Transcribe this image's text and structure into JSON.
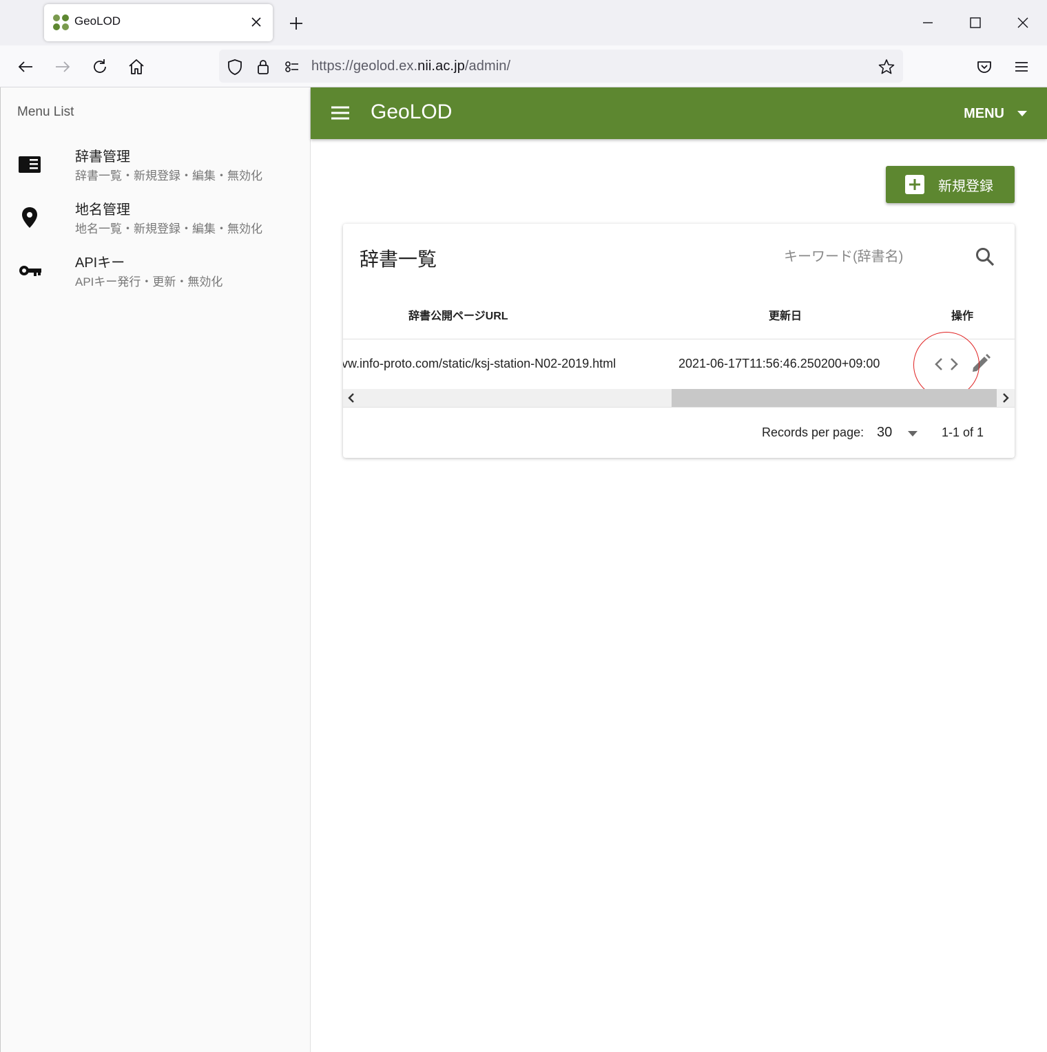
{
  "browser": {
    "tab_title": "GeoLOD",
    "url_prefix": "https://geolod.ex.",
    "url_host": "nii.ac.jp",
    "url_path": "/admin/"
  },
  "sidebar": {
    "title": "Menu List",
    "items": [
      {
        "label": "辞書管理",
        "sub": "辞書一覧・新規登録・編集・無効化",
        "icon": "book-icon"
      },
      {
        "label": "地名管理",
        "sub": "地名一覧・新規登録・編集・無効化",
        "icon": "map-pin-icon"
      },
      {
        "label": "APIキー",
        "sub": "APIキー発行・更新・無効化",
        "icon": "key-icon"
      }
    ]
  },
  "appbar": {
    "title": "GeoLOD",
    "menu_label": "MENU"
  },
  "main": {
    "new_button_label": "新規登録",
    "card_title": "辞書一覧",
    "search_placeholder": "キーワード(辞書名)",
    "columns": [
      "辞書公開ページURL",
      "更新日",
      "操作"
    ],
    "rows": [
      {
        "url": "vw.info-proto.com/static/ksj-station-N02-2019.html",
        "updated": "2021-06-17T11:56:46.250200+09:00"
      }
    ],
    "records_per_page_label": "Records per page:",
    "records_per_page_value": "30",
    "pagination_text": "1-1 of 1"
  },
  "colors": {
    "accent": "#5d8730",
    "highlight_ring": "#e02020"
  }
}
